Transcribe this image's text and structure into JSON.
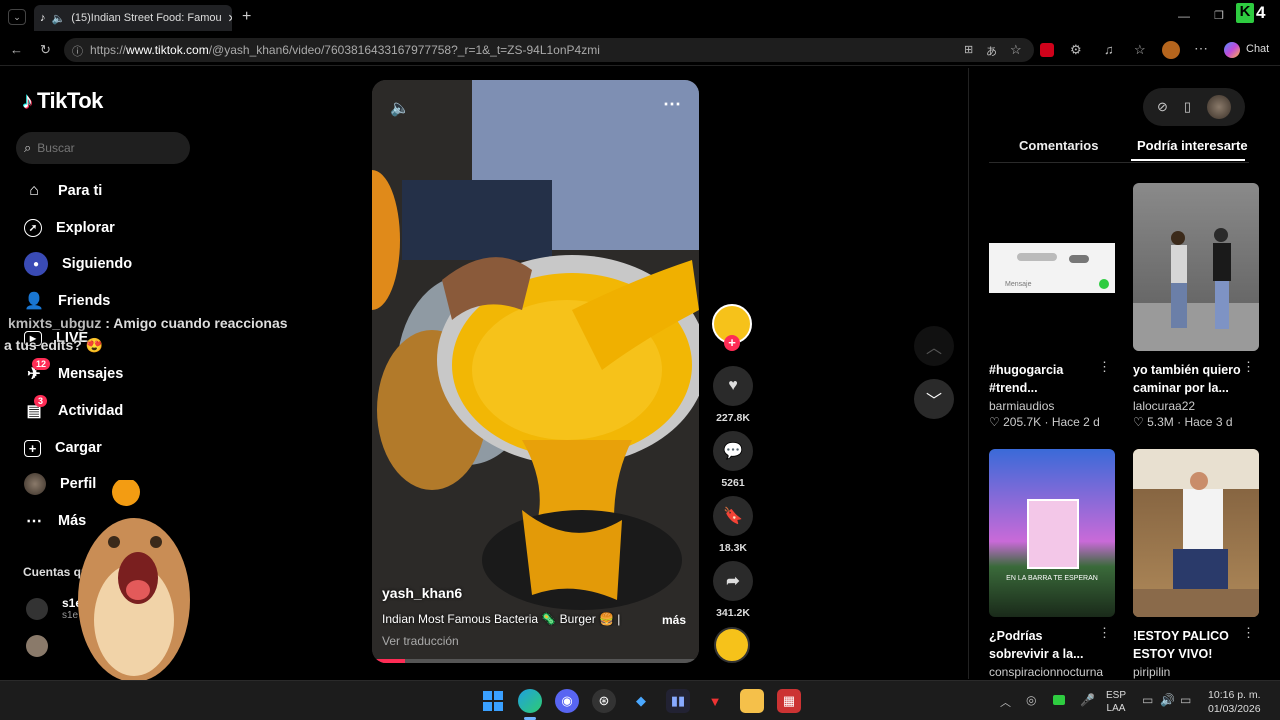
{
  "browser": {
    "tab_title": "(15)Indian Street Food: Famou",
    "url_prefix": "https://",
    "url_host": "www.tiktok.com",
    "url_path": "/@yash_khan6/video/7603816433167977758?_r=1&_t=ZS-94L1onP4zmi",
    "chat_label": "Chat"
  },
  "sidebar": {
    "logo": "TikTok",
    "search_placeholder": "Buscar",
    "items": [
      {
        "label": "Para ti",
        "icon": "home-icon"
      },
      {
        "label": "Explorar",
        "icon": "compass-icon"
      },
      {
        "label": "Siguiendo",
        "icon": "following-icon"
      },
      {
        "label": "Friends",
        "icon": "friends-icon"
      },
      {
        "label": "LIVE",
        "icon": "live-icon"
      },
      {
        "label": "Mensajes",
        "icon": "messages-icon",
        "badge": "12"
      },
      {
        "label": "Actividad",
        "icon": "activity-icon",
        "badge": "3"
      },
      {
        "label": "Cargar",
        "icon": "upload-icon"
      },
      {
        "label": "Perfil",
        "icon": "avatar"
      },
      {
        "label": "Más",
        "icon": "more-icon"
      }
    ],
    "following_header": "Cuentas que",
    "following": [
      {
        "name": "s1ez",
        "sub": "s1e"
      },
      {
        "name": "",
        "sub": ""
      }
    ]
  },
  "overlay_chat": {
    "user": "kmixts_ubguz",
    "message_line1": ": Amigo cuando reaccionas",
    "message_line2": "a tus edits?"
  },
  "video": {
    "author": "yash_khan6",
    "caption": "Indian Most Famous Bacteria 🦠 Burger 🍔 |",
    "more": "más",
    "translate": "Ver traducción",
    "progress": 0.1
  },
  "actions": {
    "likes": "227.8K",
    "comments": "5261",
    "saves": "18.3K",
    "shares": "341.2K"
  },
  "right": {
    "tabs": [
      "Comentarios",
      "Podría interesarte"
    ],
    "active_tab": 1,
    "cards": [
      {
        "title": "#hugogarcia #trend...",
        "author": "barmiaudios",
        "likes": "205.7K",
        "time": "Hace 2 d"
      },
      {
        "title": "yo también quiero caminar por la...",
        "author": "lalocuraa22",
        "likes": "5.3M",
        "time": "Hace 3 d"
      },
      {
        "title": "¿Podrías sobrevivir a la...",
        "author": "conspiracionnocturna",
        "likes": "",
        "time": ""
      },
      {
        "title": "!ESTOY PALICO ESTOY VIVO!",
        "author": "piripilin",
        "likes": "",
        "time": ""
      }
    ],
    "card1_audio_label": "Mensaje",
    "card3_overlay": "EN LA BARRA TE ESPERAN"
  },
  "taskbar": {
    "lang1": "ESP",
    "lang2": "LAA",
    "time": "10:16 p. m.",
    "date": "01/03/2026"
  },
  "colors": {
    "accent": "#fe2c55",
    "bg": "#000000",
    "panel": "#121212"
  }
}
